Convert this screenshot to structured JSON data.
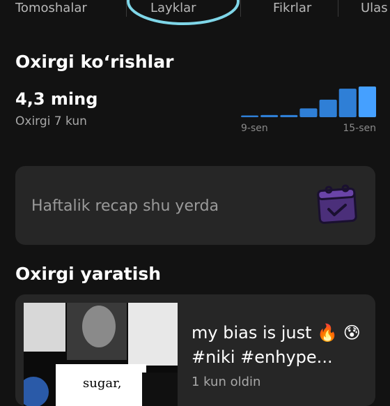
{
  "tabs": [
    {
      "label": "Tomoshalar"
    },
    {
      "label": "Layklar"
    },
    {
      "label": "Fikrlar"
    },
    {
      "label": "Ulas"
    }
  ],
  "recent_views": {
    "heading": "Oxirgi ko‘rishlar",
    "value": "4,3 ming",
    "period": "Oxirgi 7 kun"
  },
  "chart_data": {
    "type": "bar",
    "x_tick_labels": [
      "9-sen",
      "15-sen"
    ],
    "values": [
      0.04,
      0.05,
      0.05,
      0.2,
      0.4,
      0.65,
      0.7
    ],
    "highlight_index": 6,
    "colors": {
      "bar": "#2f7fd6",
      "highlight": "#45a0ff"
    }
  },
  "recap": {
    "text": "Haftalik recap shu yerda",
    "icon": "calendar-check-icon"
  },
  "recent_creation": {
    "heading": "Oxirgi yaratish",
    "title": "my bias is just 🔥 😰#niki #enhype...",
    "time": "1 kun oldin",
    "thumbnail_text": "sugar,"
  },
  "colors": {
    "background": "#121212",
    "card": "#262626",
    "accent_circle": "#7fd6e8",
    "recap_icon": "#5a3a8a"
  }
}
